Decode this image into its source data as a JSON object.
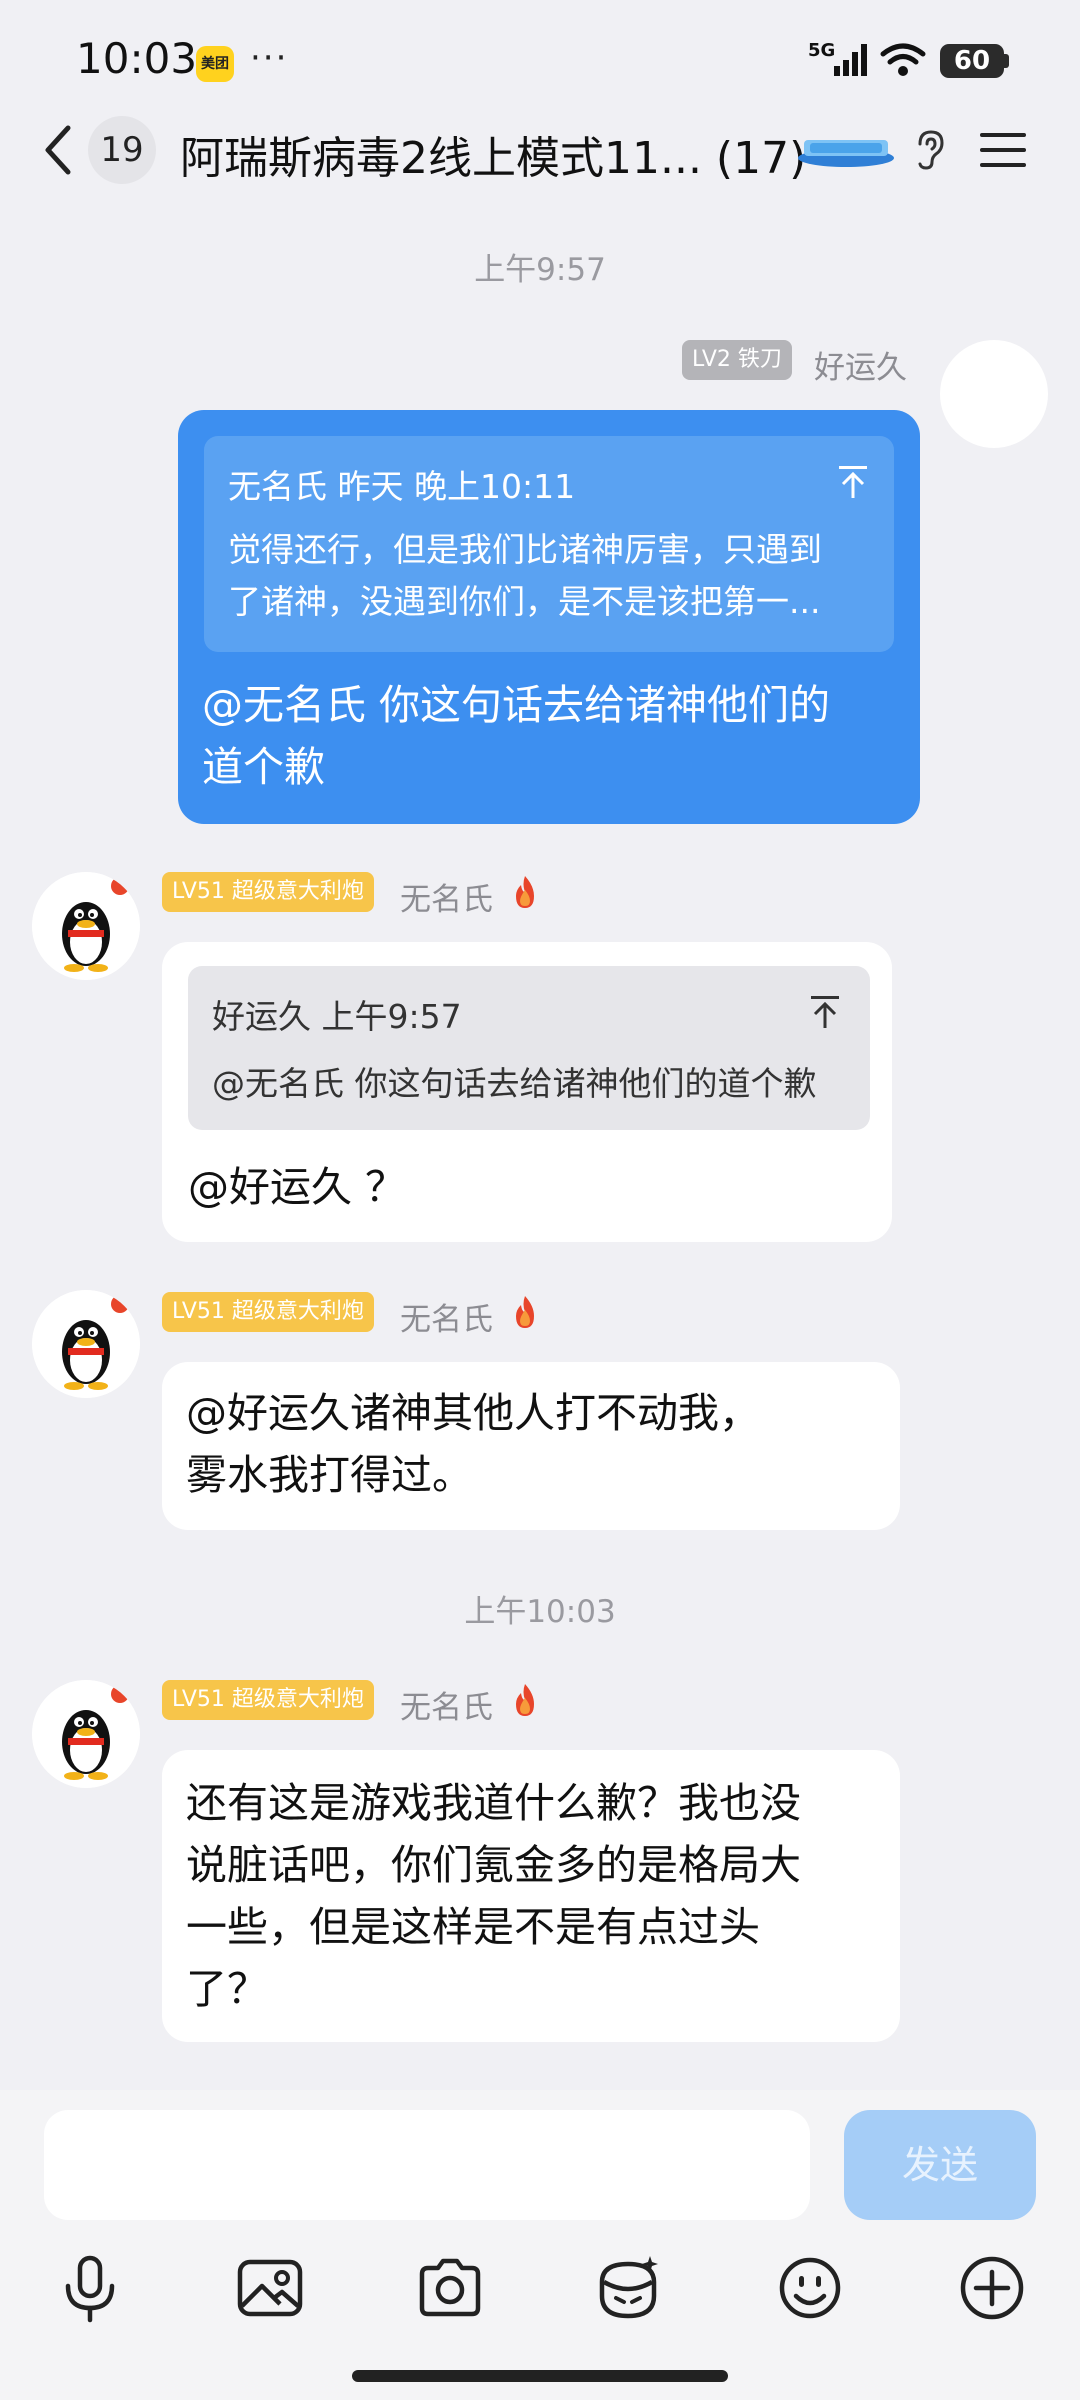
{
  "status_bar": {
    "time": "10:03",
    "app_badge": "美团",
    "dots": "···",
    "network": "5G",
    "battery": "60"
  },
  "header": {
    "unread_count": "19",
    "title": "阿瑞斯病毒2线上模式11... (17)"
  },
  "messages": {
    "time1": "上午9:57",
    "time2": "上午10:03",
    "m1": {
      "level": "LV2 铁刀",
      "sender": "好运久",
      "quote_author_time": "无名氏  昨天  晚上10:11",
      "quote_line1": "觉得还行，但是我们比诸神厉害，只遇到",
      "quote_line2": "了诸神，没遇到你们，是不是该把第一...",
      "text_line1": "@无名氏 你这句话去给诸神他们的",
      "text_line2": "道个歉"
    },
    "m2": {
      "level": "LV51 超级意大利炮",
      "sender": "无名氏",
      "quote_author_time": "好运久  上午9:57",
      "quote_text": "@无名氏 你这句话去给诸神他们的道个歉",
      "text": "@好运久 ？"
    },
    "m3": {
      "level": "LV51 超级意大利炮",
      "sender": "无名氏",
      "text_line1": "@好运久诸神其他人打不动我，",
      "text_line2": "雾水我打得过。"
    },
    "m4": {
      "level": "LV51 超级意大利炮",
      "sender": "无名氏",
      "text_line1": "还有这是游戏我道什么歉？我也没",
      "text_line2": "说脏话吧，你们氪金多的是格局大",
      "text_line3": "一些，但是这样是不是有点过头",
      "text_line4": "了？"
    }
  },
  "input": {
    "placeholder": "",
    "send_label": "发送"
  },
  "toolbar": {
    "icons": [
      "microphone-icon",
      "image-icon",
      "camera-icon",
      "red-packet-icon",
      "emoji-icon",
      "plus-icon"
    ]
  },
  "colors": {
    "self_bubble": "#3d8ff0",
    "self_quote": "#5aa2f2",
    "other_bubble": "#ffffff",
    "gold_badge": "#f7c54a",
    "send_button": "#a5cdf7",
    "background": "#f0f0f4"
  }
}
